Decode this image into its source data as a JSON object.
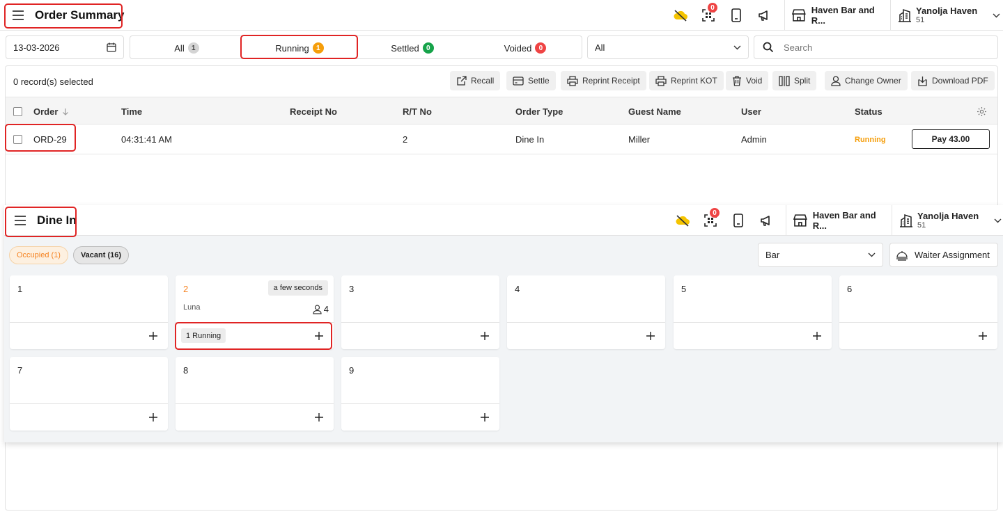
{
  "order_summary": {
    "title": "Order Summary",
    "header": {
      "qr_badge": "0",
      "venue": "Haven Bar and R...",
      "user_name": "Yanolja Haven",
      "user_sub": "51"
    },
    "date": "13-03-2026",
    "tabs": [
      {
        "label": "All",
        "count": "1",
        "color": "#d4d4d4"
      },
      {
        "label": "Running",
        "count": "1",
        "color": "#f59e0b"
      },
      {
        "label": "Settled",
        "count": "0",
        "color": "#16a34a"
      },
      {
        "label": "Voided",
        "count": "0",
        "color": "#ef4444"
      }
    ],
    "filter_select": "All",
    "search_placeholder": "Search",
    "selected_text": "0 record(s) selected",
    "actions": [
      "Recall",
      "Settle",
      "Reprint Receipt",
      "Reprint KOT",
      "Void",
      "Split",
      "Change Owner",
      "Download PDF"
    ],
    "columns": [
      "Order",
      "Time",
      "Receipt No",
      "R/T No",
      "Order Type",
      "Guest Name",
      "User",
      "Status"
    ],
    "rows": [
      {
        "order": "ORD-29",
        "time": "04:31:41 AM",
        "receipt": "",
        "rt": "2",
        "type": "Dine In",
        "guest": "Miller",
        "user": "Admin",
        "status": "Running",
        "pay": "Pay 43.00"
      }
    ],
    "status_color": "#f59e0b"
  },
  "dine_in": {
    "title": "Dine In",
    "header": {
      "qr_badge": "0",
      "venue": "Haven Bar and R...",
      "user_name": "Yanolja Haven",
      "user_sub": "51"
    },
    "filters": [
      {
        "label": "Occupied (1)"
      },
      {
        "label": "Vacant (16)"
      }
    ],
    "area_select": "Bar",
    "waiter_button": "Waiter Assignment",
    "tables": [
      {
        "num": "1"
      },
      {
        "num": "2",
        "time": "a few seconds",
        "guest": "Luna",
        "pax": "4",
        "running": "1 Running"
      },
      {
        "num": "3"
      },
      {
        "num": "4"
      },
      {
        "num": "5"
      },
      {
        "num": "6"
      },
      {
        "num": "7"
      },
      {
        "num": "8"
      },
      {
        "num": "9"
      }
    ],
    "occupied_color": "#f58220"
  }
}
